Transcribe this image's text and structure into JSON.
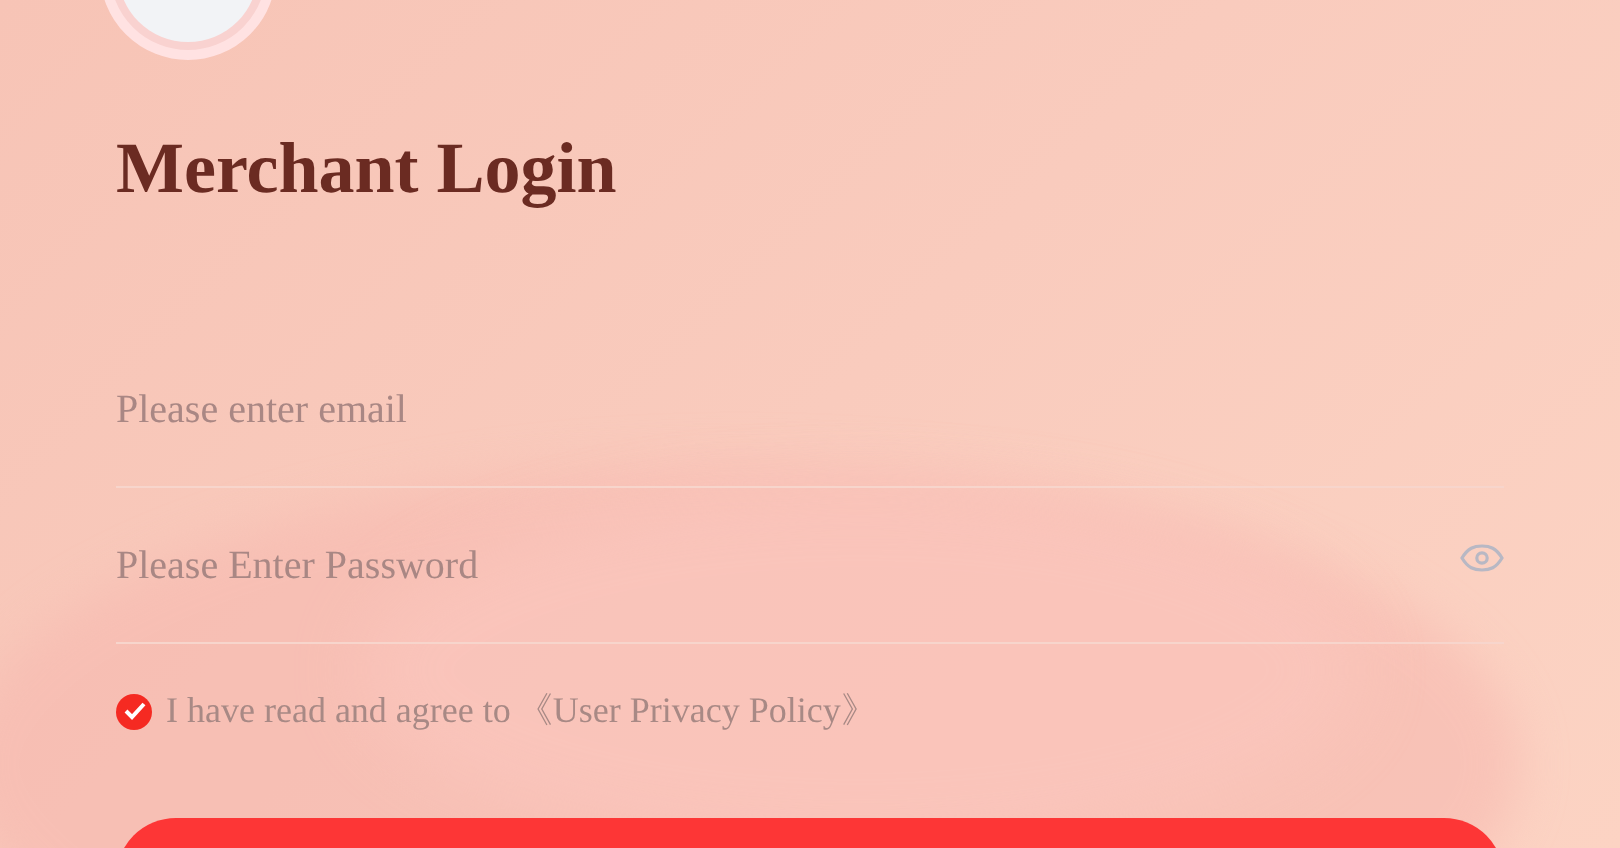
{
  "title": "Merchant Login",
  "email": {
    "placeholder": "Please enter email"
  },
  "password": {
    "placeholder": "Please Enter Password"
  },
  "agreement": {
    "checked": true,
    "text": "I have read and agree to",
    "link": "《User Privacy Policy》"
  }
}
